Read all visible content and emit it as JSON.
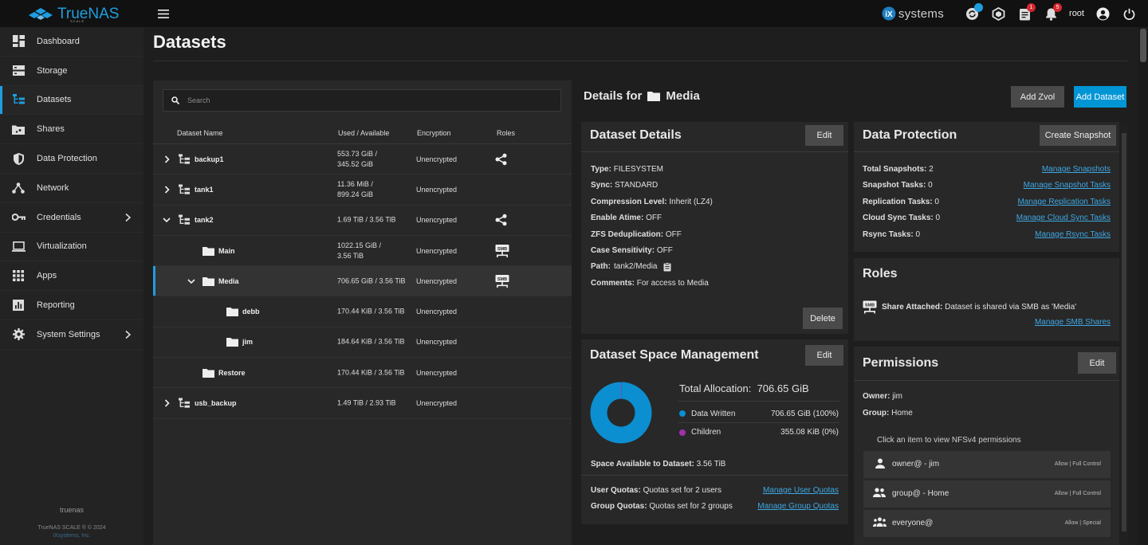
{
  "brand": {
    "name": "TrueNAS",
    "sub": "SCALE"
  },
  "topbar": {
    "vendor": "systems",
    "vendor_prefix": "iX",
    "badges": {
      "jobs": "",
      "updates": "",
      "tasks": "1",
      "alerts": "5"
    },
    "user": "root"
  },
  "sidebar": {
    "items": [
      {
        "label": "Dashboard",
        "icon": "dashboard-icon"
      },
      {
        "label": "Storage",
        "icon": "storage-icon"
      },
      {
        "label": "Datasets",
        "icon": "datasets-icon",
        "active": true
      },
      {
        "label": "Shares",
        "icon": "shares-icon"
      },
      {
        "label": "Data Protection",
        "icon": "shield-icon"
      },
      {
        "label": "Network",
        "icon": "network-icon"
      },
      {
        "label": "Credentials",
        "icon": "key-icon",
        "expandable": true
      },
      {
        "label": "Virtualization",
        "icon": "laptop-icon"
      },
      {
        "label": "Apps",
        "icon": "apps-grid-icon"
      },
      {
        "label": "Reporting",
        "icon": "chart-icon"
      },
      {
        "label": "System Settings",
        "icon": "gear-icon",
        "expandable": true
      }
    ],
    "footer": {
      "hostname": "truenas",
      "copyright": "TrueNAS SCALE ® © 2024",
      "company": "iXsystems, Inc."
    }
  },
  "page": {
    "title": "Datasets"
  },
  "tree": {
    "search_placeholder": "Search",
    "columns": {
      "name": "Dataset Name",
      "used": "Used / Available",
      "encryption": "Encryption",
      "roles": "Roles"
    },
    "rows": [
      {
        "name": "backup1",
        "used": "553.73 GiB /",
        "avail": "345.52 GiB",
        "encryption": "Unencrypted",
        "role": "share"
      },
      {
        "name": "tank1",
        "used": "11.36 MiB /",
        "avail": "899.24 GiB",
        "encryption": "Unencrypted",
        "role": ""
      },
      {
        "name": "tank2",
        "used": "1.69 TiB / 3.56 TiB",
        "avail": "",
        "encryption": "Unencrypted",
        "role": "share"
      },
      {
        "name": "Main",
        "used": "1022.15 GiB /",
        "avail": "3.56 TiB",
        "encryption": "Unencrypted",
        "role": "smb"
      },
      {
        "name": "Media",
        "used": "706.65 GiB / 3.56 TiB",
        "avail": "",
        "encryption": "Unencrypted",
        "role": "smb"
      },
      {
        "name": "debb",
        "used": "170.44 KiB / 3.56 TiB",
        "avail": "",
        "encryption": "Unencrypted",
        "role": ""
      },
      {
        "name": "jim",
        "used": "184.64 KiB / 3.56 TiB",
        "avail": "",
        "encryption": "Unencrypted",
        "role": ""
      },
      {
        "name": "Restore",
        "used": "170.44 KiB / 3.56 TiB",
        "avail": "",
        "encryption": "Unencrypted",
        "role": ""
      },
      {
        "name": "usb_backup",
        "used": "1.49 TiB / 2.93 TiB",
        "avail": "",
        "encryption": "Unencrypted",
        "role": ""
      }
    ]
  },
  "details": {
    "prefix": "Details for",
    "dataset": "Media",
    "add_zvol": "Add Zvol",
    "add_dataset": "Add Dataset"
  },
  "dataset_details": {
    "title": "Dataset Details",
    "edit": "Edit",
    "delete": "Delete",
    "fields": [
      {
        "k": "Type:",
        "v": "FILESYSTEM"
      },
      {
        "k": "Sync:",
        "v": "STANDARD"
      },
      {
        "k": "Compression Level:",
        "v": "Inherit (LZ4)"
      },
      {
        "k": "Enable Atime:",
        "v": "OFF"
      },
      {
        "k": "ZFS Deduplication:",
        "v": "OFF"
      },
      {
        "k": "Case Sensitivity:",
        "v": "OFF"
      },
      {
        "k": "Path:",
        "v": "tank2/Media"
      },
      {
        "k": "Comments:",
        "v": "For access to Media"
      }
    ]
  },
  "space": {
    "title": "Dataset Space Management",
    "edit": "Edit",
    "total_label": "Total Allocation:",
    "total_value": "706.65 GiB",
    "written_label": "Data Written",
    "written_value": "706.65 GiB (100%)",
    "children_label": "Children",
    "children_value": "355.08 KiB (0%)",
    "colors": {
      "written": "#0b8fd0",
      "children": "#a12fae"
    },
    "written_fraction": 0.9995,
    "available_label": "Space Available to Dataset:",
    "available_value": "3.56 TiB",
    "user_quotas_label": "User Quotas:",
    "user_quotas_value": "Quotas set for 2 users",
    "user_quotas_link": "Manage User Quotas",
    "group_quotas_label": "Group Quotas:",
    "group_quotas_value": "Quotas set for 2 groups",
    "group_quotas_link": "Manage Group Quotas"
  },
  "protection": {
    "title": "Data Protection",
    "create_snapshot": "Create Snapshot",
    "rows": [
      {
        "k": "Total Snapshots:",
        "v": "2",
        "link": "Manage Snapshots"
      },
      {
        "k": "Snapshot Tasks:",
        "v": "0",
        "link": "Manage Snapshot Tasks"
      },
      {
        "k": "Replication Tasks:",
        "v": "0",
        "link": "Manage Replication Tasks"
      },
      {
        "k": "Cloud Sync Tasks:",
        "v": "0",
        "link": "Manage Cloud Sync Tasks"
      },
      {
        "k": "Rsync Tasks:",
        "v": "0",
        "link": "Manage Rsync Tasks"
      }
    ]
  },
  "roles": {
    "title": "Roles",
    "share_label": "Share Attached:",
    "share_text": "Dataset is shared via SMB as 'Media'",
    "link": "Manage SMB Shares"
  },
  "permissions": {
    "title": "Permissions",
    "edit": "Edit",
    "owner_label": "Owner:",
    "owner": "jim",
    "group_label": "Group:",
    "group": "Home",
    "hint": "Click an item to view NFSv4 permissions",
    "entries": [
      {
        "name": "owner@ - jim",
        "perm": "Allow | Full Control",
        "icon": "person-icon"
      },
      {
        "name": "group@ - Home",
        "perm": "Allow | Full Control",
        "icon": "group-icon"
      },
      {
        "name": "everyone@",
        "perm": "Allow | Special",
        "icon": "everyone-icon"
      }
    ]
  }
}
